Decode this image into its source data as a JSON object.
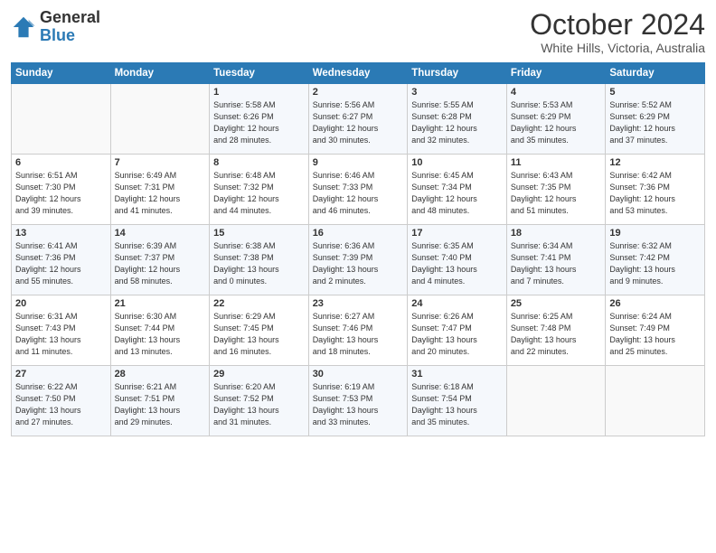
{
  "logo": {
    "text_general": "General",
    "text_blue": "Blue"
  },
  "header": {
    "month": "October 2024",
    "location": "White Hills, Victoria, Australia"
  },
  "days_of_week": [
    "Sunday",
    "Monday",
    "Tuesday",
    "Wednesday",
    "Thursday",
    "Friday",
    "Saturday"
  ],
  "weeks": [
    [
      {
        "day": "",
        "info": ""
      },
      {
        "day": "",
        "info": ""
      },
      {
        "day": "1",
        "info": "Sunrise: 5:58 AM\nSunset: 6:26 PM\nDaylight: 12 hours\nand 28 minutes."
      },
      {
        "day": "2",
        "info": "Sunrise: 5:56 AM\nSunset: 6:27 PM\nDaylight: 12 hours\nand 30 minutes."
      },
      {
        "day": "3",
        "info": "Sunrise: 5:55 AM\nSunset: 6:28 PM\nDaylight: 12 hours\nand 32 minutes."
      },
      {
        "day": "4",
        "info": "Sunrise: 5:53 AM\nSunset: 6:29 PM\nDaylight: 12 hours\nand 35 minutes."
      },
      {
        "day": "5",
        "info": "Sunrise: 5:52 AM\nSunset: 6:29 PM\nDaylight: 12 hours\nand 37 minutes."
      }
    ],
    [
      {
        "day": "6",
        "info": "Sunrise: 6:51 AM\nSunset: 7:30 PM\nDaylight: 12 hours\nand 39 minutes."
      },
      {
        "day": "7",
        "info": "Sunrise: 6:49 AM\nSunset: 7:31 PM\nDaylight: 12 hours\nand 41 minutes."
      },
      {
        "day": "8",
        "info": "Sunrise: 6:48 AM\nSunset: 7:32 PM\nDaylight: 12 hours\nand 44 minutes."
      },
      {
        "day": "9",
        "info": "Sunrise: 6:46 AM\nSunset: 7:33 PM\nDaylight: 12 hours\nand 46 minutes."
      },
      {
        "day": "10",
        "info": "Sunrise: 6:45 AM\nSunset: 7:34 PM\nDaylight: 12 hours\nand 48 minutes."
      },
      {
        "day": "11",
        "info": "Sunrise: 6:43 AM\nSunset: 7:35 PM\nDaylight: 12 hours\nand 51 minutes."
      },
      {
        "day": "12",
        "info": "Sunrise: 6:42 AM\nSunset: 7:36 PM\nDaylight: 12 hours\nand 53 minutes."
      }
    ],
    [
      {
        "day": "13",
        "info": "Sunrise: 6:41 AM\nSunset: 7:36 PM\nDaylight: 12 hours\nand 55 minutes."
      },
      {
        "day": "14",
        "info": "Sunrise: 6:39 AM\nSunset: 7:37 PM\nDaylight: 12 hours\nand 58 minutes."
      },
      {
        "day": "15",
        "info": "Sunrise: 6:38 AM\nSunset: 7:38 PM\nDaylight: 13 hours\nand 0 minutes."
      },
      {
        "day": "16",
        "info": "Sunrise: 6:36 AM\nSunset: 7:39 PM\nDaylight: 13 hours\nand 2 minutes."
      },
      {
        "day": "17",
        "info": "Sunrise: 6:35 AM\nSunset: 7:40 PM\nDaylight: 13 hours\nand 4 minutes."
      },
      {
        "day": "18",
        "info": "Sunrise: 6:34 AM\nSunset: 7:41 PM\nDaylight: 13 hours\nand 7 minutes."
      },
      {
        "day": "19",
        "info": "Sunrise: 6:32 AM\nSunset: 7:42 PM\nDaylight: 13 hours\nand 9 minutes."
      }
    ],
    [
      {
        "day": "20",
        "info": "Sunrise: 6:31 AM\nSunset: 7:43 PM\nDaylight: 13 hours\nand 11 minutes."
      },
      {
        "day": "21",
        "info": "Sunrise: 6:30 AM\nSunset: 7:44 PM\nDaylight: 13 hours\nand 13 minutes."
      },
      {
        "day": "22",
        "info": "Sunrise: 6:29 AM\nSunset: 7:45 PM\nDaylight: 13 hours\nand 16 minutes."
      },
      {
        "day": "23",
        "info": "Sunrise: 6:27 AM\nSunset: 7:46 PM\nDaylight: 13 hours\nand 18 minutes."
      },
      {
        "day": "24",
        "info": "Sunrise: 6:26 AM\nSunset: 7:47 PM\nDaylight: 13 hours\nand 20 minutes."
      },
      {
        "day": "25",
        "info": "Sunrise: 6:25 AM\nSunset: 7:48 PM\nDaylight: 13 hours\nand 22 minutes."
      },
      {
        "day": "26",
        "info": "Sunrise: 6:24 AM\nSunset: 7:49 PM\nDaylight: 13 hours\nand 25 minutes."
      }
    ],
    [
      {
        "day": "27",
        "info": "Sunrise: 6:22 AM\nSunset: 7:50 PM\nDaylight: 13 hours\nand 27 minutes."
      },
      {
        "day": "28",
        "info": "Sunrise: 6:21 AM\nSunset: 7:51 PM\nDaylight: 13 hours\nand 29 minutes."
      },
      {
        "day": "29",
        "info": "Sunrise: 6:20 AM\nSunset: 7:52 PM\nDaylight: 13 hours\nand 31 minutes."
      },
      {
        "day": "30",
        "info": "Sunrise: 6:19 AM\nSunset: 7:53 PM\nDaylight: 13 hours\nand 33 minutes."
      },
      {
        "day": "31",
        "info": "Sunrise: 6:18 AM\nSunset: 7:54 PM\nDaylight: 13 hours\nand 35 minutes."
      },
      {
        "day": "",
        "info": ""
      },
      {
        "day": "",
        "info": ""
      }
    ]
  ]
}
